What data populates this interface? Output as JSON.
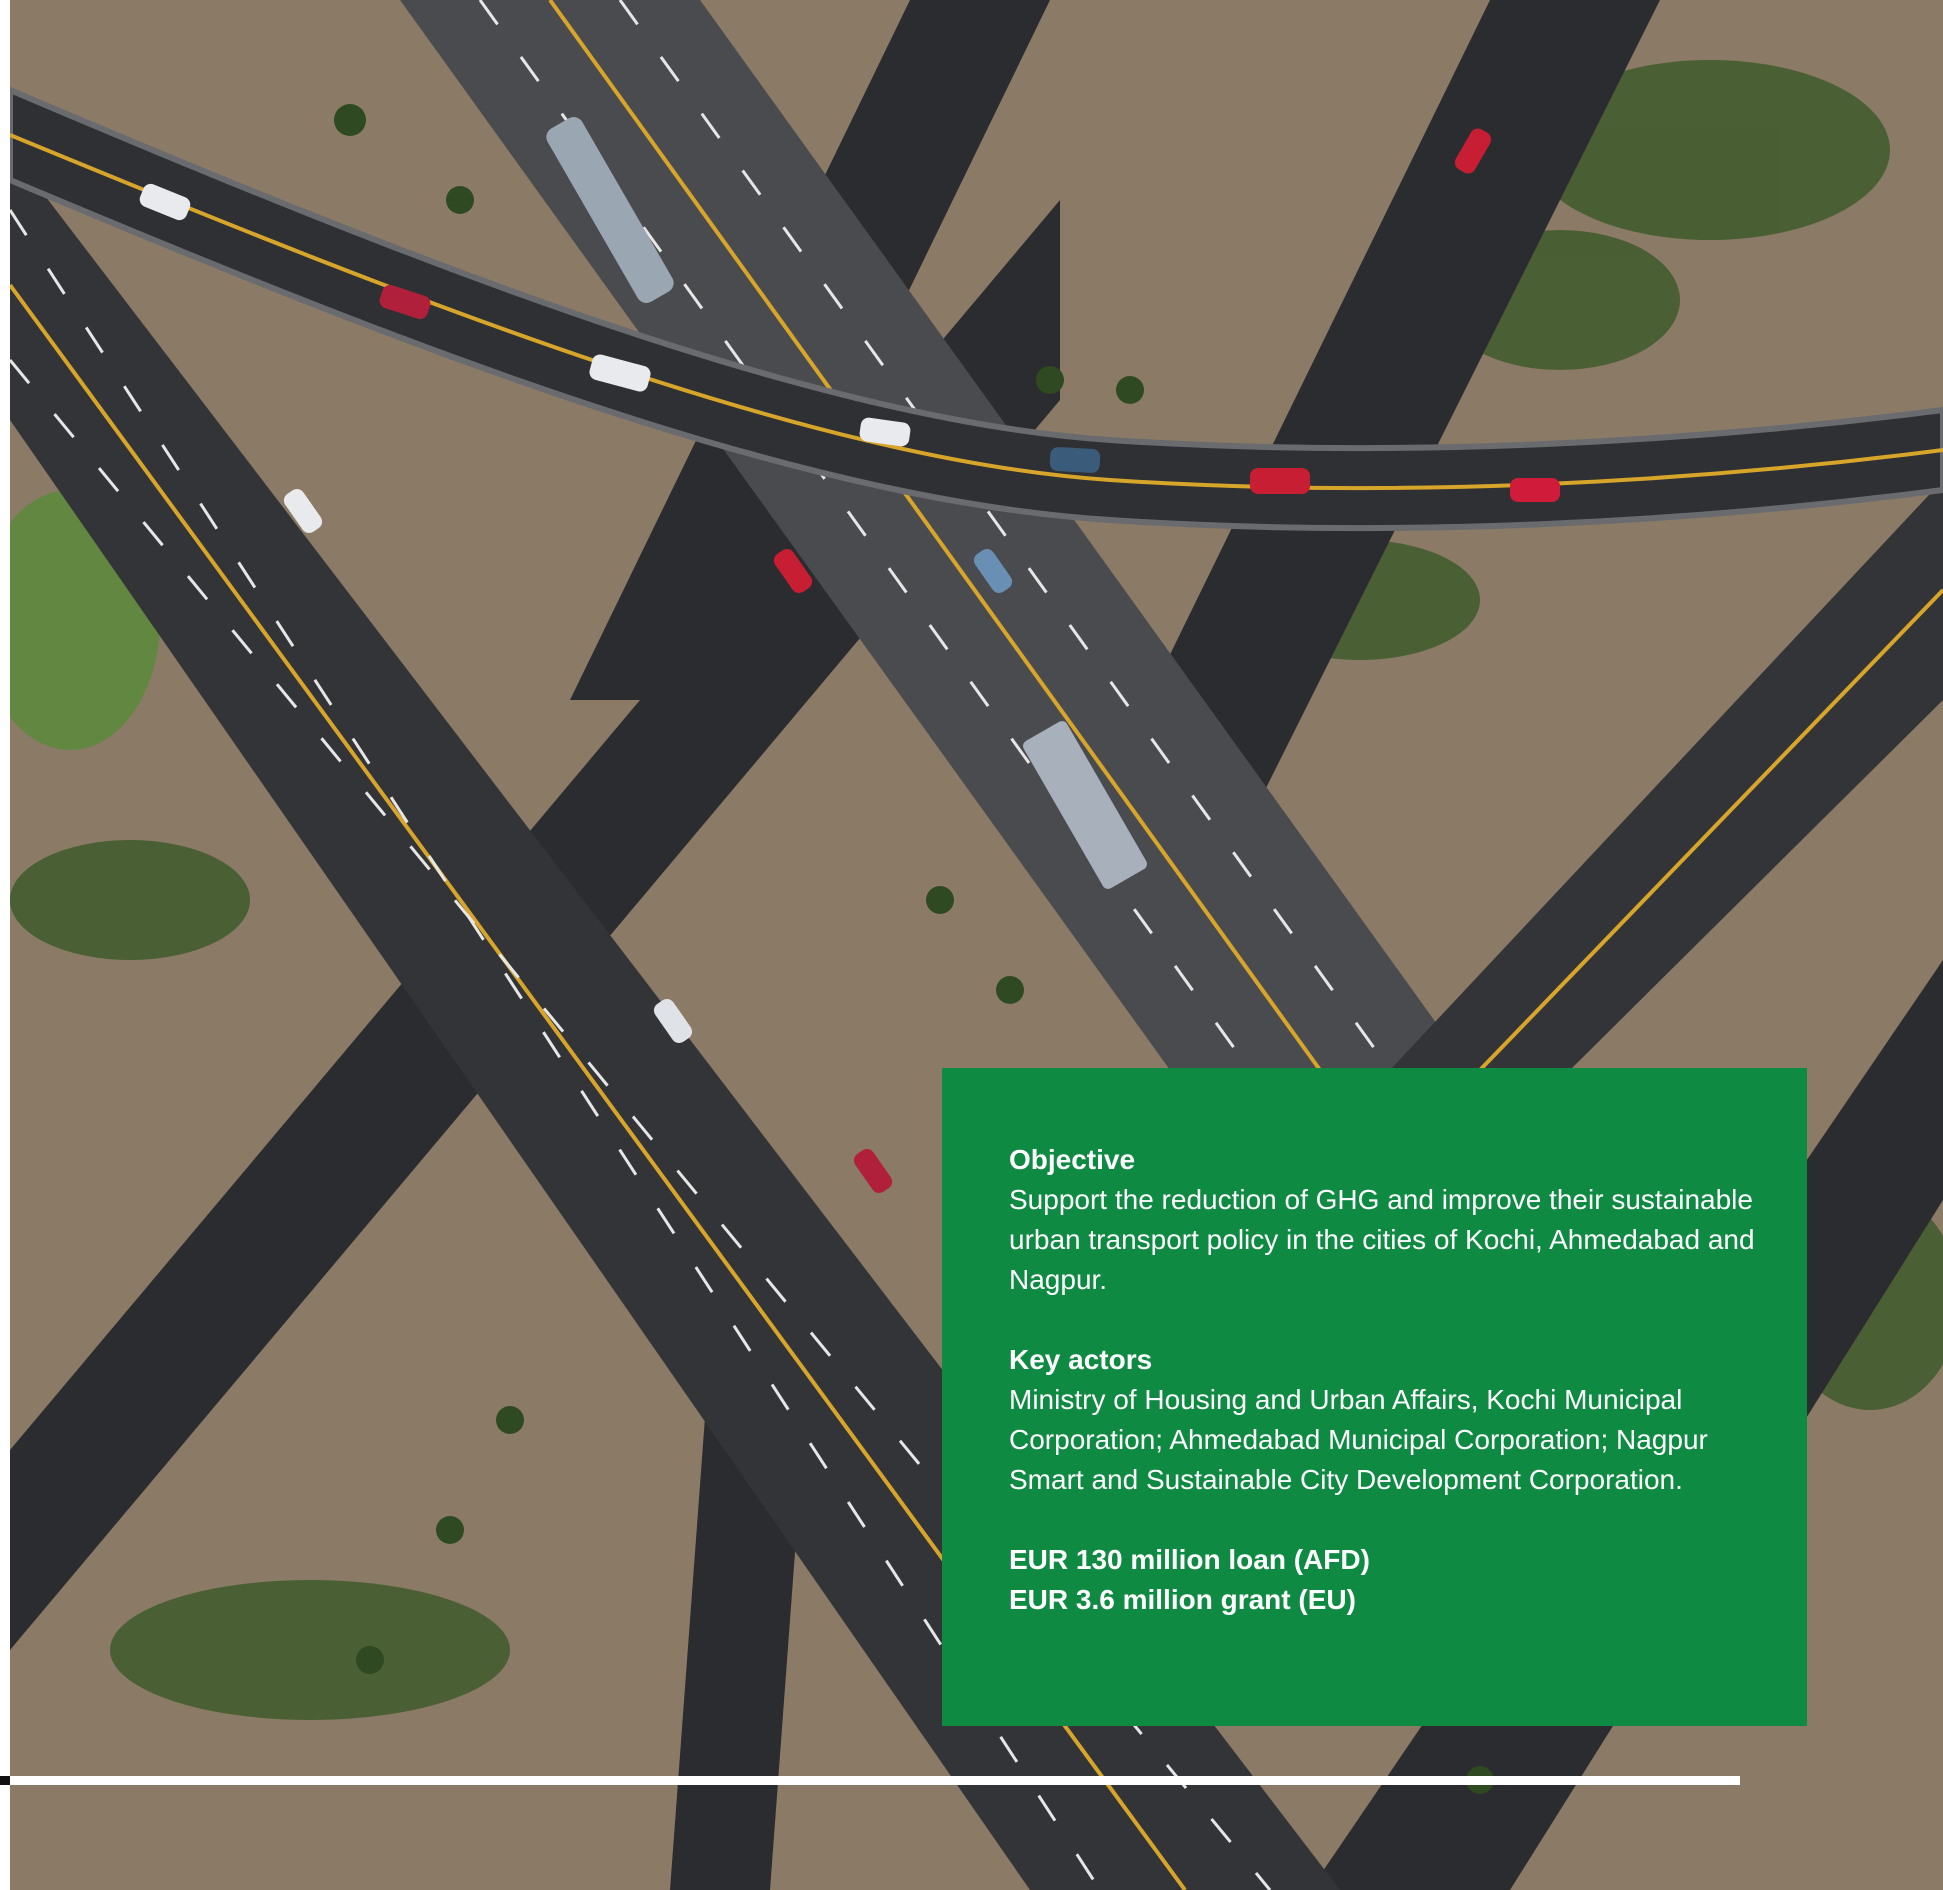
{
  "photo": {
    "subject": "aerial-highway-interchange",
    "colors": {
      "ground": "#8a7a66",
      "asphalt": "#2b2c30",
      "overpass": "#56575b",
      "vegetation": "#3f5a2c",
      "lane_marking": "#e6e6e6",
      "yellow_line": "#d7a52a"
    }
  },
  "info_box": {
    "background": "#0f8a43",
    "objective": {
      "heading": "Objective",
      "body": "Support the reduction of GHG and improve their sustainable urban transport policy in the cities of Kochi, Ahmedabad and Nagpur."
    },
    "key_actors": {
      "heading": "Key actors",
      "body": "Ministry of Housing and Urban Affairs, Kochi Municipal Corporation; Ahmedabad Municipal Corporation; Nagpur Smart and Sustainable City Development Corporation."
    },
    "funding": {
      "loan": "EUR 130 million loan (AFD)",
      "grant": "EUR 3.6 million grant (EU)"
    }
  },
  "footer_rule": {
    "color": "#ffffff"
  }
}
